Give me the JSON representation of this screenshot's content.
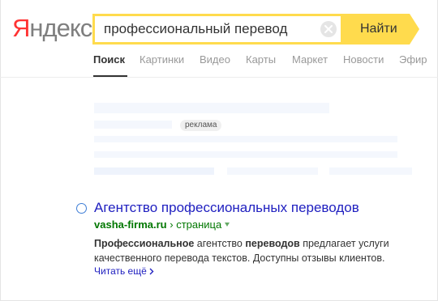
{
  "header": {
    "logo_first": "Я",
    "logo_rest": "ндекс",
    "search_query": "профессиональный перевод",
    "find_button": "Найти"
  },
  "tabs": [
    {
      "label": "Поиск",
      "active": true
    },
    {
      "label": "Картинки"
    },
    {
      "label": "Видео"
    },
    {
      "label": "Карты"
    },
    {
      "label": "Маркет"
    },
    {
      "label": "Новости"
    },
    {
      "label": "Эфир"
    }
  ],
  "ad": {
    "badge": "реклама"
  },
  "result": {
    "title": "Агентство профессиональных переводов",
    "domain": "vasha-firma.ru",
    "separator": "›",
    "crumb": "страница",
    "snippet": {
      "b1": "Профессиональное",
      "t1": " агентство ",
      "b2": "переводов",
      "t2": " предлагает услуги качественного перевода текстов. Доступны отзывы клиентов."
    },
    "read_more": "Читать ещё"
  },
  "colors": {
    "accent_yellow": "#ffdb4d",
    "link_blue": "#2020c0",
    "url_green": "#007700",
    "logo_red": "#ff3333"
  }
}
